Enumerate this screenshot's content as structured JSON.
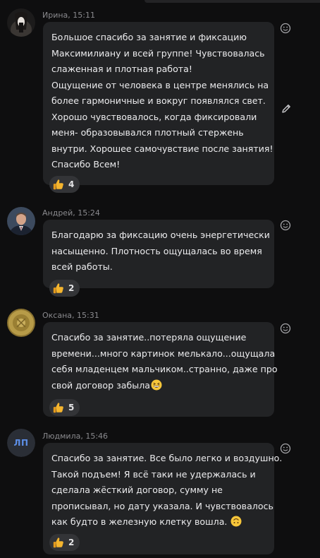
{
  "messages": [
    {
      "author": "Ирина",
      "time": "15:11",
      "meta": "Ирина, 15:11",
      "lines": [
        "Большое спасибо за занятие и фиксацию",
        "Максимилиану и всей группе! Чувствовалась",
        "слаженная и плотная работа!",
        "Ощущение от человека в центре менялись на",
        "более гармоничные и вокруг появлялся свет.",
        "Хорошо чувствовалось, когда фиксировали",
        "меня- образовывался плотный стержень",
        "внутри. Хорошее самочувствие после занятия!",
        "Спасибо Всем!"
      ],
      "reaction_count": "4",
      "reaction_icon": "thumbs-up-icon"
    },
    {
      "author": "Андрей",
      "time": "15:24",
      "meta": "Андрей, 15:24",
      "lines": [
        "Благодарю за фиксацию очень энергетически",
        "насыщенно. Плотность ощущалась во время",
        "всей работы."
      ],
      "reaction_count": "2",
      "reaction_icon": "thumbs-up-icon"
    },
    {
      "author": "Оксана",
      "time": "15:31",
      "meta": "Оксана, 15:31",
      "lines": [
        "Спасибо за занятие..потеряла ощущение",
        "времени...много картинок мелькало...ощущала",
        "себя младенцем мальчиком..странно, даже про",
        "свой договор забыла"
      ],
      "inline_emoji": "grinning-squint-emoji",
      "reaction_count": "5",
      "reaction_icon": "thumbs-up-icon"
    },
    {
      "author": "Людмила",
      "time": "15:46",
      "meta": "Людмила, 15:46",
      "avatar_initials": "ЛП",
      "lines": [
        "Спасибо за занятие. Все было легко и воздушно.",
        "Такой подъем! Я всё таки не удержалась и",
        "сделала жёсткий договор, сумму не",
        "прописывал, но дату указала. И чувствовалось",
        "как будто в железную клетку вошла."
      ],
      "inline_emoji": "upside-down-face-emoji",
      "reaction_count": "2",
      "reaction_icon": "thumbs-up-icon"
    }
  ],
  "colors": {
    "background": "#0e0e0f",
    "bubble": "#222325",
    "reaction_pill": "#333437",
    "meta_text": "#8a8a8e",
    "initials_accent": "#5d8fe8"
  }
}
